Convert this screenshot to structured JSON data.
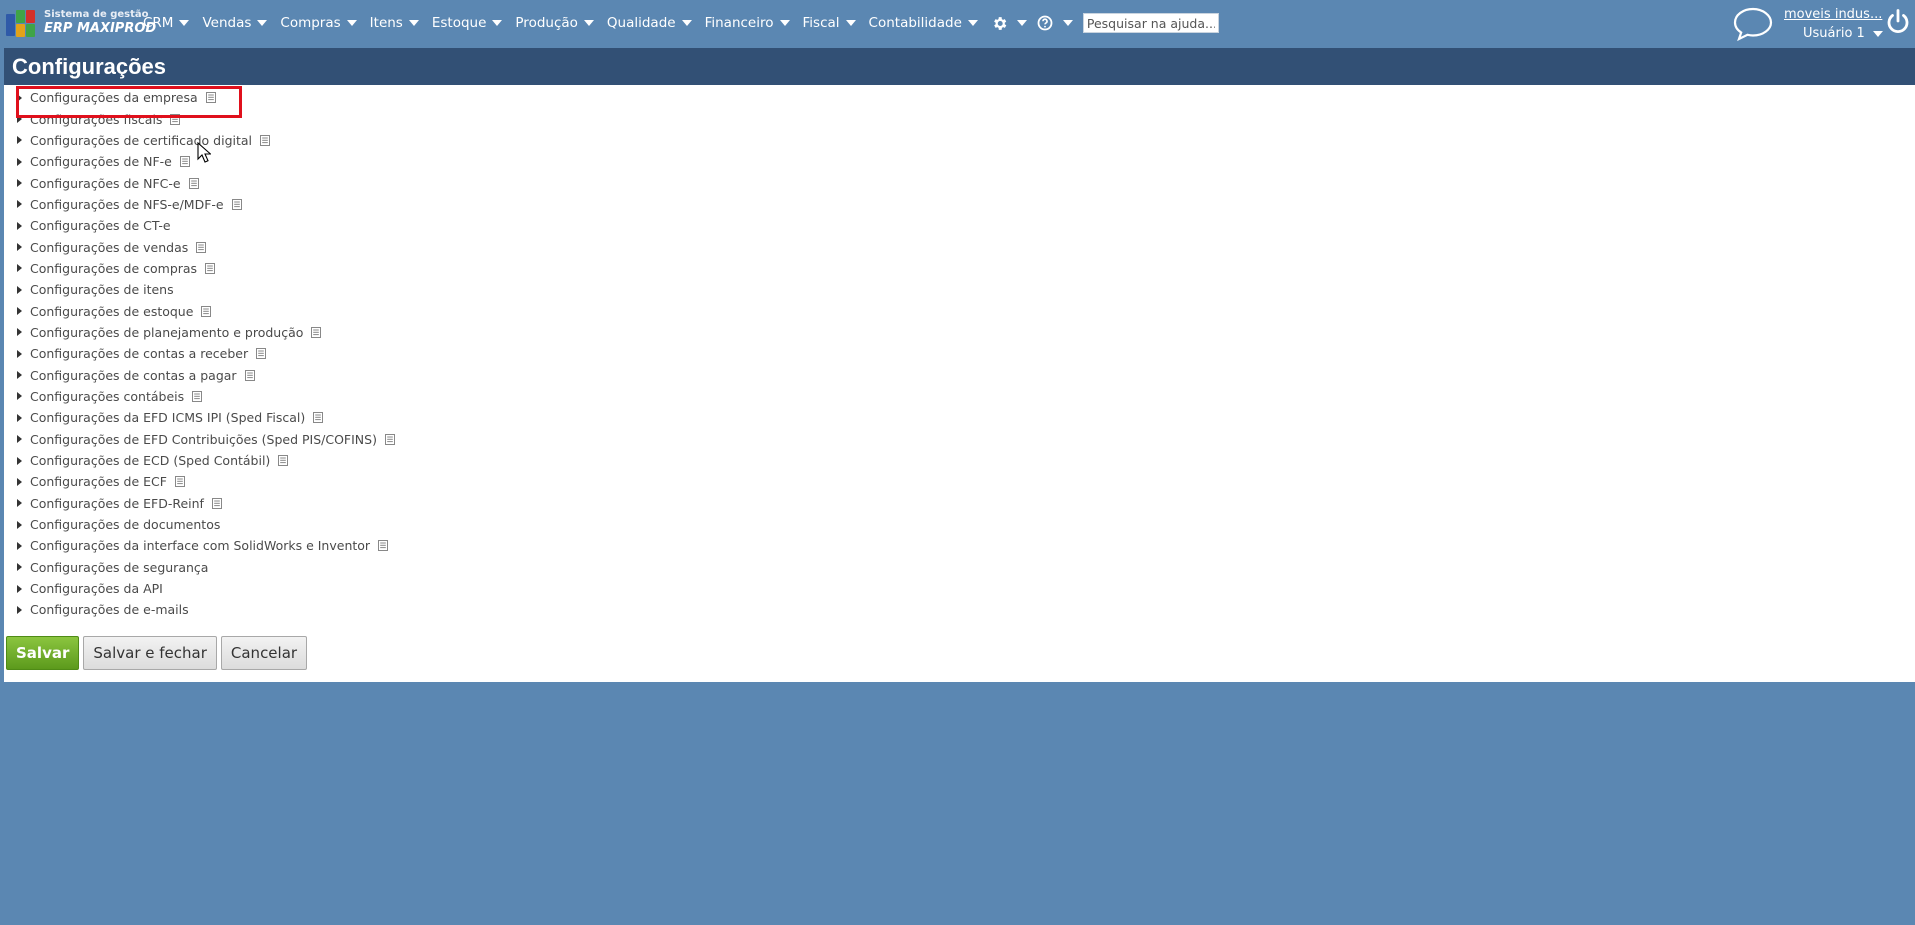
{
  "colors": {
    "accent": "#5b87b2",
    "header": "#325075",
    "save": "#6aa92a",
    "highlight": "#e0101c"
  },
  "logo": {
    "line1": "Sistema de gestão",
    "line2": "ERP MAXIPROD"
  },
  "menu": [
    {
      "label": "CRM"
    },
    {
      "label": "Vendas"
    },
    {
      "label": "Compras"
    },
    {
      "label": "Itens"
    },
    {
      "label": "Estoque"
    },
    {
      "label": "Produção"
    },
    {
      "label": "Qualidade"
    },
    {
      "label": "Financeiro"
    },
    {
      "label": "Fiscal"
    },
    {
      "label": "Contabilidade"
    }
  ],
  "icons": {
    "settings": "gear-icon",
    "help": "help-icon",
    "chat": "chat-bubble-icon",
    "power": "power-icon"
  },
  "search": {
    "placeholder": "Pesquisar na ajuda..."
  },
  "account": {
    "company": "moveis indus...",
    "user": "Usuário 1"
  },
  "page": {
    "title": "Configurações"
  },
  "sections": [
    {
      "label": "Configurações da empresa",
      "has_doc": true
    },
    {
      "label": "Configurações fiscais",
      "has_doc": true
    },
    {
      "label": "Configurações de certificado digital",
      "has_doc": true
    },
    {
      "label": "Configurações de NF-e",
      "has_doc": true
    },
    {
      "label": "Configurações de NFC-e",
      "has_doc": true
    },
    {
      "label": "Configurações de NFS-e/MDF-e",
      "has_doc": true
    },
    {
      "label": "Configurações de CT-e",
      "has_doc": false
    },
    {
      "label": "Configurações de vendas",
      "has_doc": true
    },
    {
      "label": "Configurações de compras",
      "has_doc": true
    },
    {
      "label": "Configurações de itens",
      "has_doc": false
    },
    {
      "label": "Configurações de estoque",
      "has_doc": true
    },
    {
      "label": "Configurações de planejamento e produção",
      "has_doc": true
    },
    {
      "label": "Configurações de contas a receber",
      "has_doc": true
    },
    {
      "label": "Configurações de contas a pagar",
      "has_doc": true
    },
    {
      "label": "Configurações contábeis",
      "has_doc": true
    },
    {
      "label": "Configurações da EFD ICMS IPI (Sped Fiscal)",
      "has_doc": true
    },
    {
      "label": "Configurações de EFD Contribuições (Sped PIS/COFINS)",
      "has_doc": true
    },
    {
      "label": "Configurações de ECD (Sped Contábil)",
      "has_doc": true
    },
    {
      "label": "Configurações de ECF",
      "has_doc": true
    },
    {
      "label": "Configurações de EFD-Reinf",
      "has_doc": true
    },
    {
      "label": "Configurações de documentos",
      "has_doc": false
    },
    {
      "label": "Configurações da interface com SolidWorks e Inventor",
      "has_doc": true
    },
    {
      "label": "Configurações de segurança",
      "has_doc": false
    },
    {
      "label": "Configurações da API",
      "has_doc": false
    },
    {
      "label": "Configurações de e-mails",
      "has_doc": false
    }
  ],
  "buttons": {
    "save": "Salvar",
    "save_close": "Salvar e fechar",
    "cancel": "Cancelar"
  }
}
